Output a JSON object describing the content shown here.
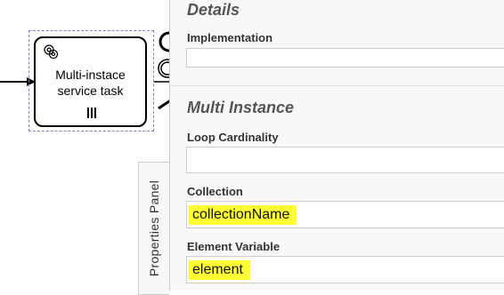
{
  "canvas": {
    "task_label": "Multi-instace\nservice task"
  },
  "panel": {
    "details_title": "Details",
    "implementation_label": "Implementation",
    "implementation_value": "",
    "multi_instance_title": "Multi Instance",
    "loop_cardinality_label": "Loop Cardinality",
    "loop_cardinality_value": "",
    "collection_label": "Collection",
    "collection_value": "collectionName",
    "element_variable_label": "Element Variable",
    "element_variable_value": "element",
    "toggle_label": "Properties Panel"
  },
  "colors": {
    "highlight": "#ffff33",
    "selection": "#7f7fd0"
  }
}
